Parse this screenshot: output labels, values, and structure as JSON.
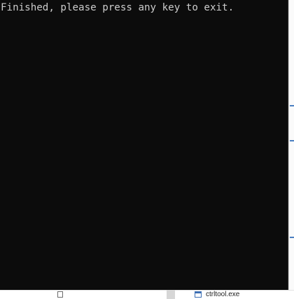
{
  "console": {
    "output_line": "Finished, please press any key to exit."
  },
  "background": {
    "items": [
      {
        "label": "",
        "icon": "file-icon"
      },
      {
        "label": "ctrltool.exe",
        "icon": "exe-icon"
      }
    ]
  },
  "colors": {
    "console_background": "#0c0c0c",
    "console_text": "#cccccc",
    "accent": "#4a7fc1"
  }
}
